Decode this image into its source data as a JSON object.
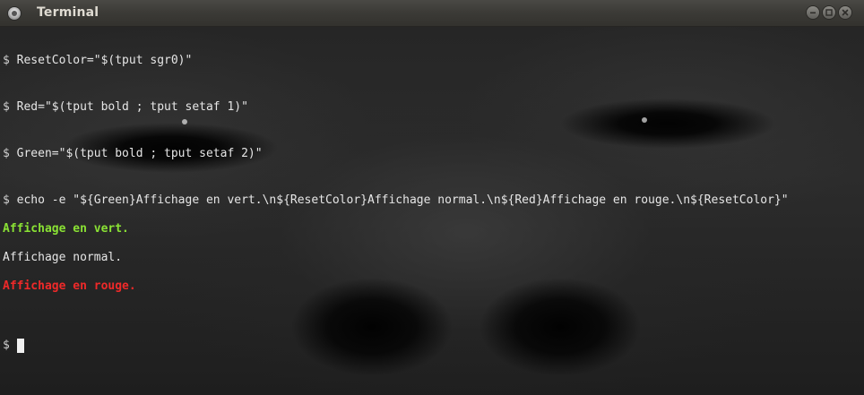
{
  "window": {
    "title": "Terminal",
    "icon": "terminal-app-icon",
    "buttons": [
      "minimize-icon",
      "maximize-icon",
      "close-icon"
    ]
  },
  "terminal": {
    "prompt": "$",
    "commands": [
      "ResetColor=\"$(tput sgr0)\"",
      "Red=\"$(tput bold ; tput setaf 1)\"",
      "Green=\"$(tput bold ; tput setaf 2)\"",
      "echo -e \"${Green}Affichage en vert.\\n${ResetColor}Affichage normal.\\n${Red}Affichage en rouge.\\n${ResetColor}\""
    ],
    "output": {
      "green": "Affichage en vert.",
      "normal": "Affichage normal.",
      "red": "Affichage en rouge."
    }
  },
  "colors": {
    "green_text": "#8ae234",
    "red_text": "#ef2929",
    "background": "#2a2a2a",
    "titlebar": "#3c3b37"
  }
}
